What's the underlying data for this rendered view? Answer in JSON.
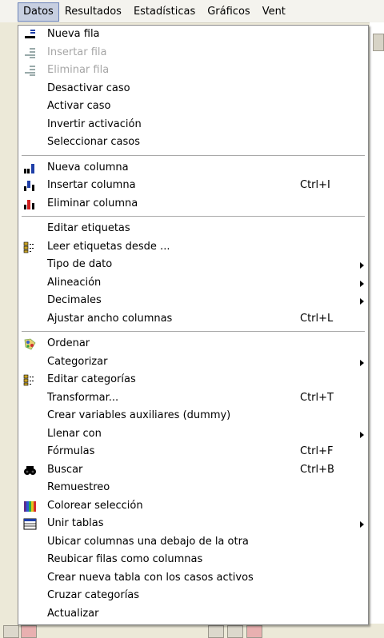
{
  "menubar": {
    "items": [
      "Datos",
      "Resultados",
      "Estadísticas",
      "Gráficos",
      "Vent"
    ]
  },
  "menu": {
    "groups": [
      [
        {
          "label": "Nueva fila",
          "icon": "new-row-icon"
        },
        {
          "label": "Insertar fila",
          "icon": "insert-row-icon",
          "disabled": true
        },
        {
          "label": "Eliminar fila",
          "icon": "delete-row-icon",
          "disabled": true
        },
        {
          "label": "Desactivar caso"
        },
        {
          "label": "Activar caso"
        },
        {
          "label": "Invertir activación"
        },
        {
          "label": "Seleccionar casos"
        }
      ],
      [
        {
          "label": "Nueva columna",
          "icon": "new-column-icon"
        },
        {
          "label": "Insertar columna",
          "icon": "insert-column-icon",
          "shortcut": "Ctrl+I"
        },
        {
          "label": "Eliminar columna",
          "icon": "delete-column-icon"
        }
      ],
      [
        {
          "label": "Editar etiquetas"
        },
        {
          "label": "Leer etiquetas desde ...",
          "icon": "labels-icon"
        },
        {
          "label": "Tipo de dato",
          "submenu": true
        },
        {
          "label": "Alineación",
          "submenu": true
        },
        {
          "label": "Decimales",
          "submenu": true
        },
        {
          "label": "Ajustar ancho columnas",
          "shortcut": "Ctrl+L"
        }
      ],
      [
        {
          "label": "Ordenar",
          "icon": "sort-icon"
        },
        {
          "label": "Categorizar",
          "submenu": true
        },
        {
          "label": "Editar categorías",
          "icon": "categories-icon"
        },
        {
          "label": "Transformar...",
          "shortcut": "Ctrl+T"
        },
        {
          "label": "Crear variables auxiliares (dummy)"
        },
        {
          "label": "Llenar con",
          "submenu": true
        },
        {
          "label": "Fórmulas",
          "shortcut": "Ctrl+F"
        },
        {
          "label": "Buscar",
          "icon": "binoculars-icon",
          "shortcut": "Ctrl+B"
        },
        {
          "label": "Remuestreo"
        },
        {
          "label": "Colorear selección",
          "icon": "color-bars-icon"
        },
        {
          "label": "Unir tablas",
          "icon": "join-tables-icon",
          "submenu": true
        },
        {
          "label": "Ubicar columnas una debajo de la otra"
        },
        {
          "label": "Reubicar filas como columnas"
        },
        {
          "label": "Crear nueva tabla con los casos activos"
        },
        {
          "label": "Cruzar categorías"
        },
        {
          "label": "Actualizar"
        }
      ]
    ]
  }
}
